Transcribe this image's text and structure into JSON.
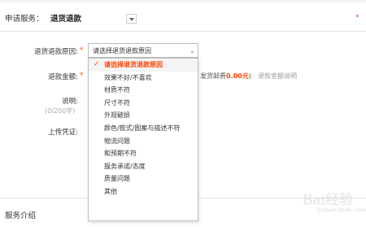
{
  "service": {
    "label": "申请服务：",
    "value": "退货退款",
    "required_mark": "*"
  },
  "form": {
    "reason_label": "退货退款原因:",
    "required_mark": "*",
    "reason_select": {
      "selected_text": "请选择退货退款原因",
      "caret": "⌄"
    },
    "amount_label": "退款金额:",
    "amount_tail_prefix": "发货邮费",
    "amount_tail_value": "0.00元",
    "amount_tail_suffix": ")",
    "amount_help": "退款金额说明",
    "desc_label": "说明:",
    "desc_counter": "(0/200字)",
    "upload_label": "上传凭证:"
  },
  "dropdown": {
    "check": "✓",
    "items": [
      "请选择退货退款原因",
      "效果不好/不喜欢",
      "材质不符",
      "尺寸不符",
      "外观破损",
      "颜色/款式/图案与描述不符",
      "物流问题",
      "和预期不符",
      "服务承诺/态度",
      "质量问题",
      "其他"
    ]
  },
  "footer": {
    "section_title": "服务介绍"
  },
  "watermark": {
    "text": "Bai经验",
    "url": "jingyan.baidu.com"
  },
  "colors": {
    "accent": "#ff4400",
    "border": "#bdbdbd"
  }
}
